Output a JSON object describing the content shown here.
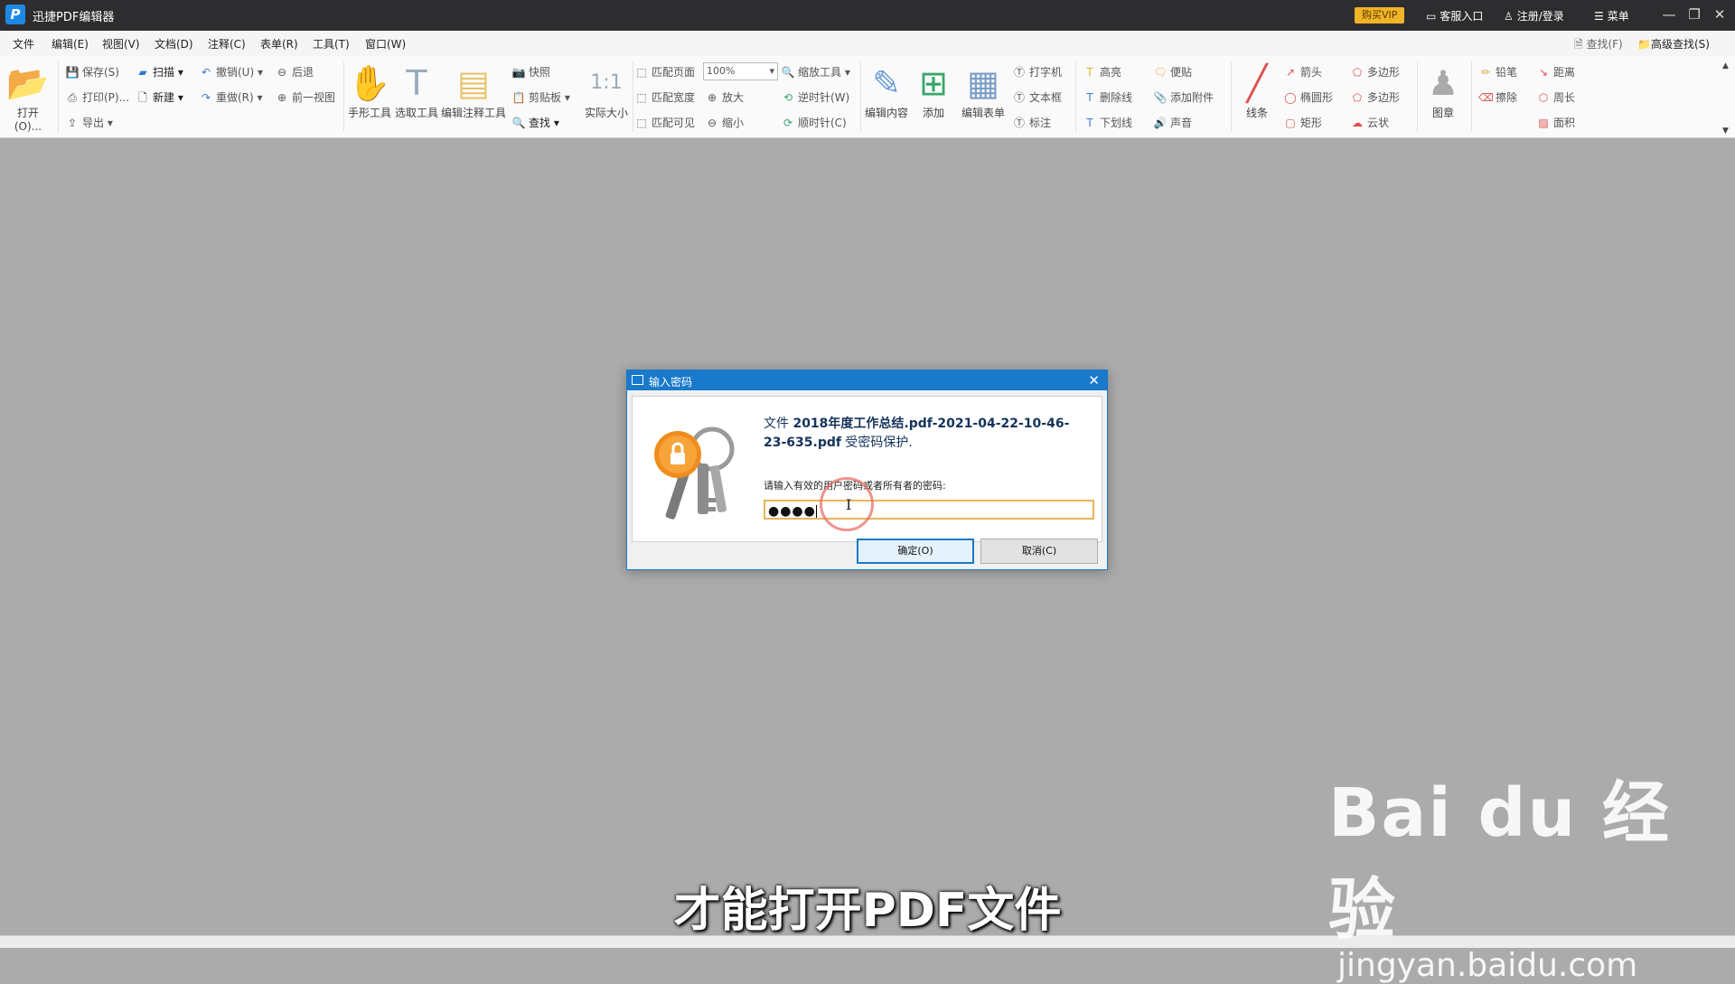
{
  "app": {
    "title": "迅捷PDF编辑器",
    "logo_letter": "P"
  },
  "topbar": {
    "vip": "购买VIP",
    "service": "客服入口",
    "login": "注册/登录",
    "menu": "菜单"
  },
  "menus": [
    "文件",
    "编辑(E)",
    "视图(V)",
    "文档(D)",
    "注释(C)",
    "表单(R)",
    "工具(T)",
    "窗口(W)"
  ],
  "search": {
    "find": "查找(F)",
    "advanced": "高级查找(S)"
  },
  "ribbon": {
    "open": "打开(O)...",
    "save": "保存(S)",
    "print": "打印(P)...",
    "export": "导出",
    "scan": "扫描",
    "new": "新建",
    "undo": "撤销(U)",
    "redo": "重做(R)",
    "back": "后退",
    "prev_view": "前一视图",
    "hand": "手形工具",
    "select": "选取工具",
    "edit_annot": "编辑注释工具",
    "snapshot": "快照",
    "clipboard": "剪贴板",
    "find": "查找",
    "actual_size": "实际大小",
    "fit_page": "匹配页面",
    "fit_width": "匹配宽度",
    "fit_visible": "匹配可见",
    "zoom_value": "100%",
    "zoom_tool": "缩放工具",
    "zoom_in": "放大",
    "zoom_out": "缩小",
    "ccw": "逆时针(W)",
    "cw": "顺时针(C)",
    "edit_content": "编辑内容",
    "add": "添加",
    "edit_form": "编辑表单",
    "typewriter": "打字机",
    "textbox": "文本框",
    "callout": "标注",
    "highlight": "高亮",
    "strikeout": "删除线",
    "underline": "下划线",
    "note": "便贴",
    "attach": "添加附件",
    "sound": "声音",
    "line": "线条",
    "arrow": "箭头",
    "ellipse": "椭圆形",
    "rect": "矩形",
    "polygon1": "多边形",
    "polygon2": "多边形",
    "cloud": "云状",
    "stamp": "图章",
    "pencil": "铅笔",
    "eraser": "擦除",
    "distance": "距离",
    "perimeter": "周长",
    "area": "面积"
  },
  "dialog": {
    "title": "输入密码",
    "msg_prefix": "文件 ",
    "filename": "2018年度工作总结.pdf-2021-04-22-10-46-23-635.pdf",
    "msg_suffix": " 受密码保护.",
    "prompt": "请输入有效的用户密码或者所有者的密码:",
    "password_mask": "●●●●",
    "ok": "确定(O)",
    "cancel": "取消(C)"
  },
  "overlay": {
    "subtitle": "才能打开PDF文件",
    "watermark_brand": "Bai du 经验",
    "watermark_url": "jingyan.baidu.com"
  },
  "colors": {
    "titlebar": "#2d2d30",
    "dialog_accent": "#1979ca",
    "vip": "#f0b429",
    "workspace": "#ababab"
  }
}
